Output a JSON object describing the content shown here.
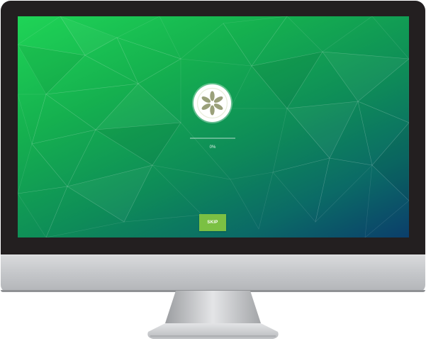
{
  "splash": {
    "progress_percent": 0,
    "progress_label": "0%",
    "skip_label": "SKIP"
  },
  "logo": {
    "icon": "cucumber-slice-icon",
    "colors": {
      "circle": "#ffffff",
      "seeds": "#9aa07a"
    }
  },
  "colors": {
    "bezel": "#231f20",
    "screen_gradient": [
      "#1fd456",
      "#15b04f",
      "#0e8c58",
      "#0b6a66",
      "#0b3e6b"
    ],
    "skip_button": "#7bc043",
    "chin": "#c6c8cb"
  }
}
